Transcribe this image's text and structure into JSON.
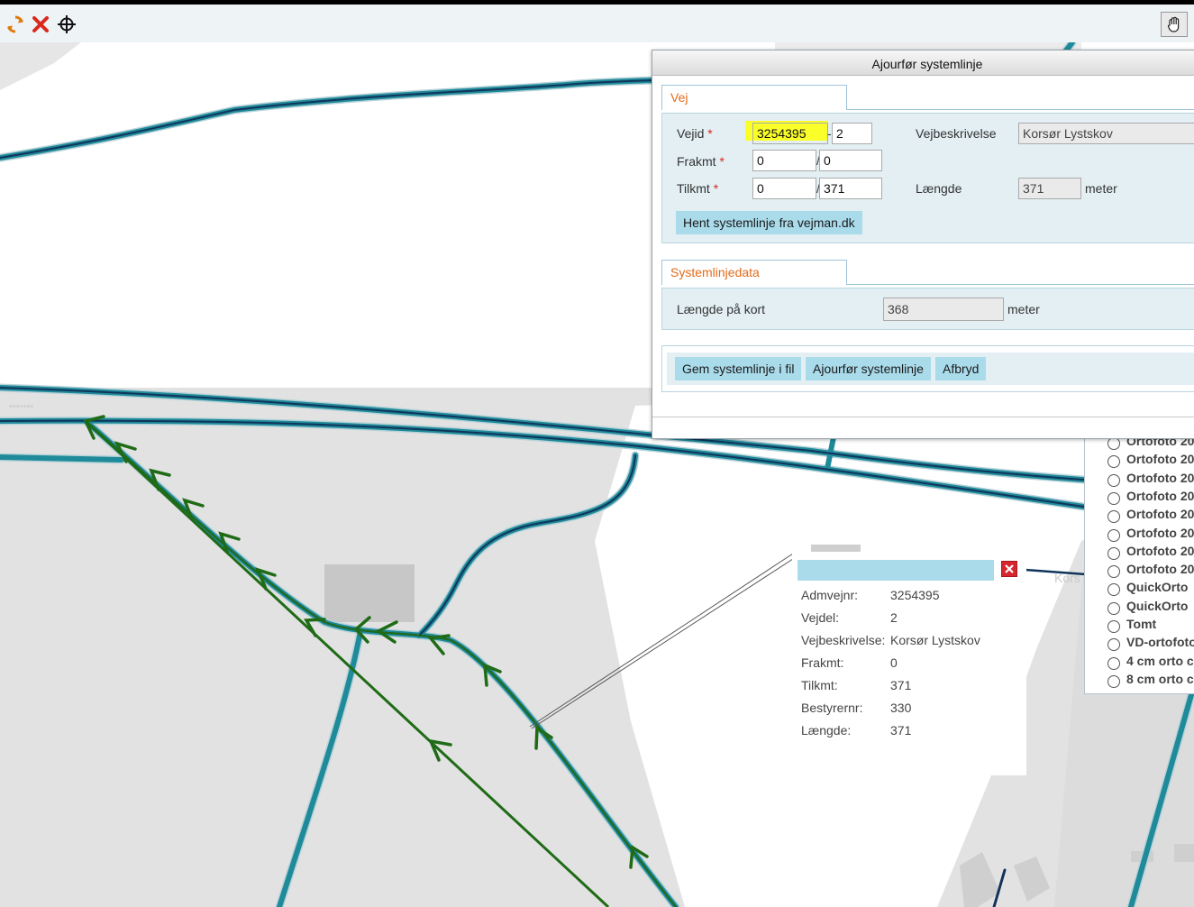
{
  "toolbar": {
    "icons": [
      "refresh-icon",
      "close-icon",
      "crosshair-icon",
      "pan-hand-icon"
    ]
  },
  "dialog": {
    "title": "Ajourfør systemlinje",
    "vej": {
      "tab_label": "Vej",
      "vejid_label": "Vejid",
      "required_mark": "*",
      "vejid_value": "3254395",
      "vejdel_separator": "-",
      "vejdel_value": "2",
      "vejbeskrivelse_label": "Vejbeskrivelse",
      "vejbeskrivelse_value": "Korsør Lystskov",
      "frakmt_label": "Frakmt",
      "frakmt_km": "0",
      "frakmt_m": "0",
      "tilkmt_label": "Tilkmt",
      "tilkmt_km": "0",
      "tilkmt_m": "371",
      "km_separator": "/",
      "laengde_label": "Længde",
      "laengde_value": "371",
      "laengde_unit": "meter",
      "fetch_button": "Hent systemlinje fra vejman.dk"
    },
    "systemlinjedata": {
      "tab_label": "Systemlinjedata",
      "laengde_kort_label": "Længde på kort",
      "laengde_kort_value": "368",
      "unit": "meter"
    },
    "actions": {
      "save_file": "Gem systemlinje i fil",
      "update": "Ajourfør systemlinje",
      "cancel": "Afbryd"
    }
  },
  "popup": {
    "rows": [
      {
        "label": "Admvejnr:",
        "value": "3254395"
      },
      {
        "label": "Vejdel:",
        "value": "2"
      },
      {
        "label": "Vejbeskrivelse:",
        "value": "Korsør Lystskov"
      },
      {
        "label": "Frakmt:",
        "value": "0"
      },
      {
        "label": "Tilkmt:",
        "value": "371"
      },
      {
        "label": "Bestyrernr:",
        "value": "330"
      },
      {
        "label": "Længde:",
        "value": "371"
      }
    ]
  },
  "layers": {
    "items": [
      "Ortofoto 20",
      "Ortofoto 20",
      "Ortofoto 20",
      "Ortofoto 20",
      "Ortofoto 20",
      "Ortofoto 20",
      "Ortofoto 20",
      "Ortofoto 20",
      "QuickOrto",
      "QuickOrto",
      "Tomt",
      "VD-ortofoto",
      "4 cm orto c",
      "8 cm orto c"
    ]
  },
  "map_labels": {
    "road_label": "Kors"
  },
  "colors": {
    "road": "#1f8a9a",
    "road_core": "#10345a",
    "direction_arrows": "#1f6b16",
    "highlight": "#fbff29",
    "button": "#aadbeb",
    "tab_text": "#e46c1a"
  }
}
